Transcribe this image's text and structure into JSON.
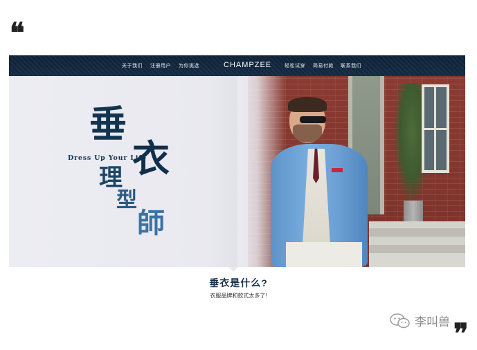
{
  "quotes": {
    "open": "❝",
    "close": "❞"
  },
  "nav": {
    "left_items": [
      "关于我们",
      "注册用户",
      "为你挑选"
    ],
    "brand": "CHAMPZEE",
    "right_items": [
      "轻松试穿",
      "简易付款",
      "联系我们"
    ]
  },
  "hero": {
    "characters": [
      "垂",
      "衣",
      "理",
      "型",
      "師"
    ],
    "tagline": "Dress Up Your Life",
    "accent_color": "#13344f"
  },
  "section": {
    "title": "垂衣是什么?",
    "subtitle": "衣服品牌和款式太多了!"
  },
  "watermark": {
    "text": "李叫兽",
    "icon": "wechat-icon"
  }
}
